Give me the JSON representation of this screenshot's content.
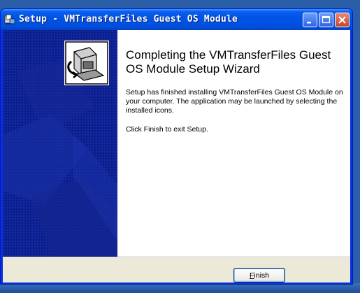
{
  "window": {
    "title": "Setup - VMTransferFiles Guest OS Module",
    "icons": {
      "app": "setup-installer-icon",
      "minimize": "minimize-icon",
      "maximize": "maximize-icon",
      "close": "close-icon"
    }
  },
  "wizard": {
    "icon": "computer-install-icon",
    "heading": "Completing the VMTransferFiles Guest OS Module Setup Wizard",
    "paragraph1": "Setup has finished installing VMTransferFiles Guest OS Module on your computer. The application may be launched by selecting the installed icons.",
    "paragraph2": "Click Finish to exit Setup."
  },
  "buttons": {
    "finish": {
      "mnemonic": "F",
      "rest": "inish"
    }
  },
  "colors": {
    "titlebar": "#0054e3",
    "side_panel": "#0c1f8f",
    "close_button": "#c9432a"
  }
}
